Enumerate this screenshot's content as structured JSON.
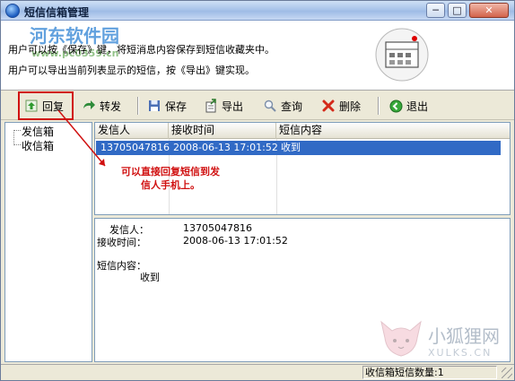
{
  "window": {
    "title": "短信信箱管理",
    "minimize": "─",
    "maximize": "□",
    "close": "✕"
  },
  "header": {
    "hint1": "用户可以按《保存》键，将短消息内容保存到短信收藏夹中。",
    "hint2": "用户可以导出当前列表显示的短信，按《导出》键实现。",
    "watermark_title": "河东软件园",
    "watermark_url": "www.pc0359.cn"
  },
  "toolbar": {
    "reply": "回复",
    "forward": "转发",
    "save": "保存",
    "export": "导出",
    "query": "查询",
    "delete": "删除",
    "exit": "退出"
  },
  "tree": {
    "items": [
      {
        "label": "发信箱"
      },
      {
        "label": "收信箱"
      }
    ]
  },
  "list": {
    "columns": [
      "发信人",
      "接收时间",
      "短信内容"
    ],
    "rows": [
      {
        "sender": "13705047816",
        "time": "2008-06-13 17:01:52",
        "content": "收到"
      }
    ]
  },
  "detail": {
    "sender_label": "发信人：",
    "sender_value": "13705047816",
    "time_label": "接收时间：",
    "time_value": "2008-06-13 17:01:52",
    "content_label": "短信内容：",
    "content_value": "收到"
  },
  "annotation": {
    "line1": "可以直接回复短信到发",
    "line2": "信人手机上。"
  },
  "status": {
    "count_text": "收信箱短信数量:1"
  },
  "brand": {
    "fox_name": "小狐狸网",
    "fox_url": "XULKS.CN"
  },
  "colors": {
    "selection": "#316ac5",
    "annotation": "#d01010",
    "titlebar": "#a9c4ea"
  }
}
